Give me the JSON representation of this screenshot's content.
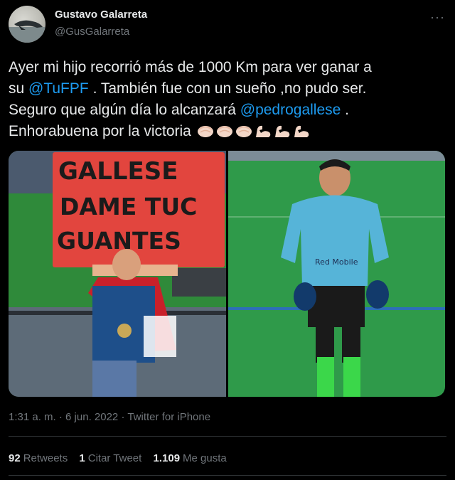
{
  "author": {
    "display_name": "Gustavo Galarreta",
    "handle": "@GusGalarreta"
  },
  "menu_icon": "more-horizontal-icon",
  "tweet": {
    "line1": "Ayer mi hijo recorrió más de 1000 Km para ver ganar a",
    "line2_prefix": "su ",
    "mention1": "@TuFPF",
    "line2_suffix": " . También fue con un sueño ,no pudo ser.",
    "line3_prefix": "Seguro que algún día lo alcanzará ",
    "mention2": "@pedrogallese",
    "line3_suffix": " .",
    "line4": "Enhorabuena por la victoria",
    "emojis": [
      "clapping-hands-icon",
      "clapping-hands-icon",
      "clapping-hands-icon",
      "flexed-biceps-icon",
      "flexed-biceps-icon",
      "flexed-biceps-icon"
    ]
  },
  "media": {
    "left_sign_lines": [
      "GALLESE",
      "DAME TUC",
      "GUANTES"
    ],
    "right_shirt_text": "Red Mobile"
  },
  "timestamp": {
    "time": "1:31 a. m.",
    "separator": " · ",
    "date": "6 jun. 2022",
    "source": "Twitter for iPhone"
  },
  "stats": {
    "retweets_count": "92",
    "retweets_label": "Retweets",
    "quotes_count": "1",
    "quotes_label": "Citar Tweet",
    "likes_count": "1.109",
    "likes_label": "Me gusta"
  },
  "colors": {
    "background": "#000000",
    "link": "#1d9bf0",
    "secondary_text": "#71767b",
    "divider": "#2f3336"
  }
}
